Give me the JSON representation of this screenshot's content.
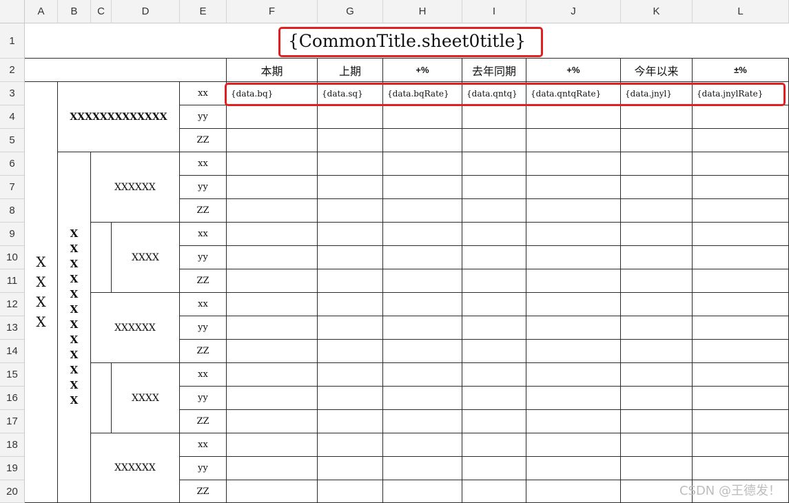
{
  "columns": [
    "A",
    "B",
    "C",
    "D",
    "E",
    "F",
    "G",
    "H",
    "I",
    "J",
    "K",
    "L"
  ],
  "rows": [
    "1",
    "2",
    "3",
    "4",
    "5",
    "6",
    "7",
    "8",
    "9",
    "10",
    "11",
    "12",
    "13",
    "14",
    "15",
    "16",
    "17",
    "18",
    "19",
    "20"
  ],
  "title": "{CommonTitle.sheet0title}",
  "headers": {
    "bq": "本期",
    "sq": "上期",
    "bqRate": "+%",
    "qntq": "去年同期",
    "qntqRate": "+%",
    "jnyl": "今年以来",
    "jnylRate": "±%"
  },
  "fields": {
    "bq": "{data.bq}",
    "sq": "{data.sq}",
    "bqRate": "{data.bqRate}",
    "qntq": "{data.qntq}",
    "qntqRate": "{data.qntqRate}",
    "jnyl": "{data.jnyl}",
    "jnylRate": "{data.jnylRate}"
  },
  "labels": {
    "group_a": [
      "X",
      "X",
      "X",
      "X"
    ],
    "group_b": [
      "X",
      "X",
      "X",
      "X",
      "X",
      "X",
      "X",
      "X",
      "X",
      "X",
      "X",
      "X"
    ],
    "group_top": "XXXXXXXXXXXXX",
    "sub1": "XXXXXX",
    "sub2": "XXXX",
    "sub3": "XXXXXX",
    "sub4": "XXXX",
    "sub5": "XXXXXX",
    "metrics": [
      "xx",
      "yy",
      "ZZ"
    ]
  },
  "highlight_color": "#e02020",
  "watermark": "CSDN @王德发！"
}
